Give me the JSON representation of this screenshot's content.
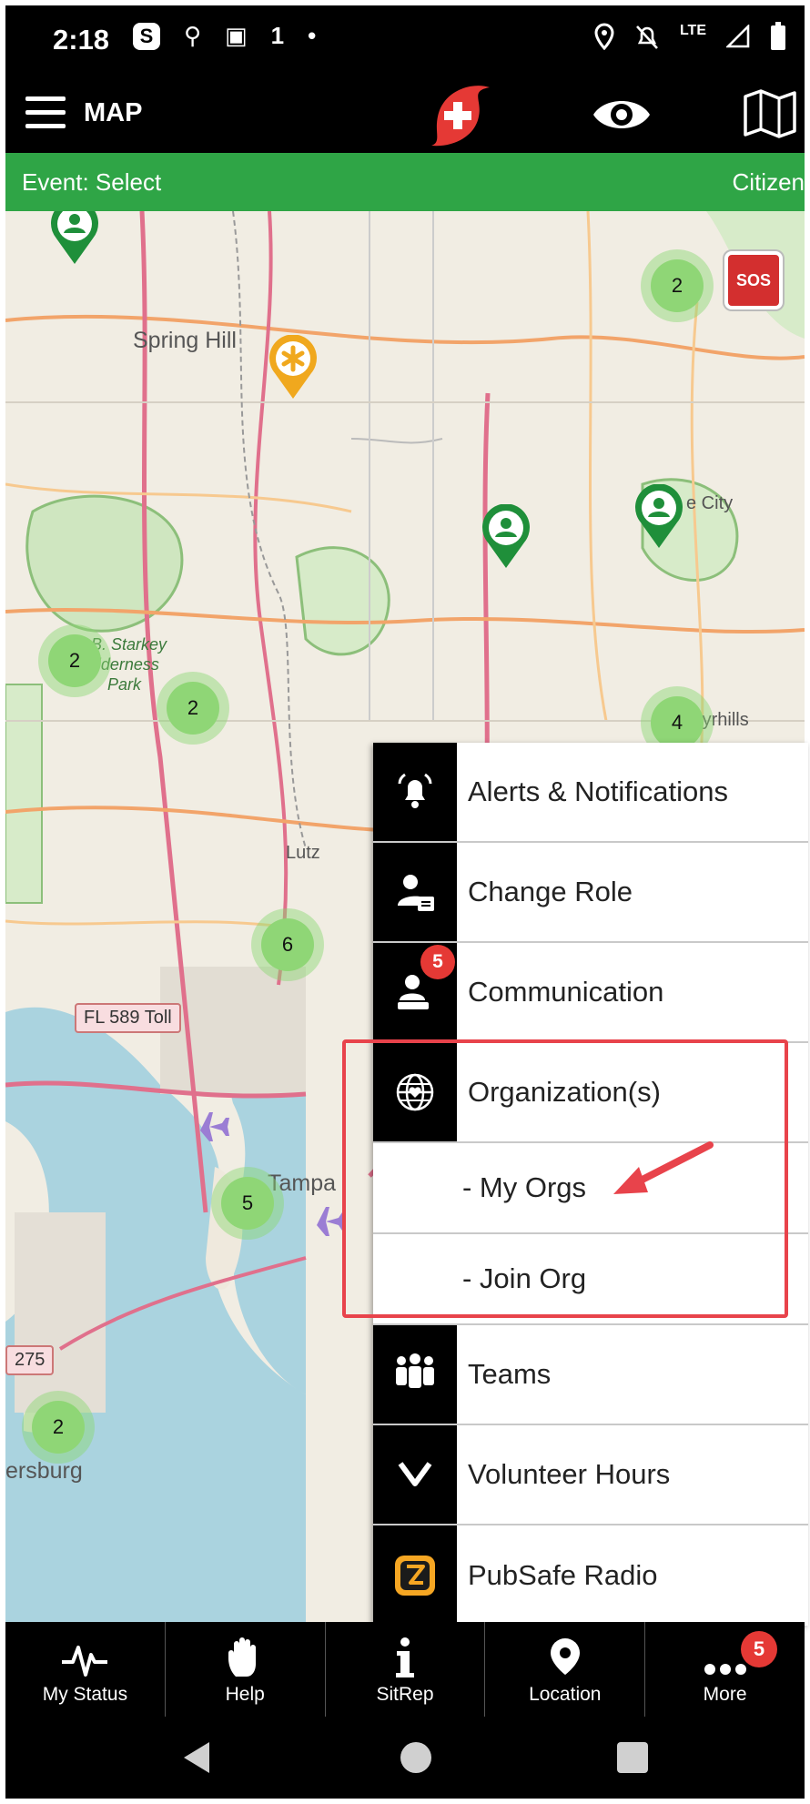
{
  "status_bar": {
    "time": "2:18",
    "icons": [
      "S",
      "⚲",
      "▣",
      "1",
      "•"
    ],
    "network": "LTE"
  },
  "app_bar": {
    "title": "MAP",
    "icons": [
      "menu-icon",
      "logo-icon",
      "eye-icon",
      "map-icon"
    ]
  },
  "event_bar": {
    "event": "Event: Select",
    "role": "Citizen"
  },
  "map": {
    "places": {
      "spring_hill": "Spring Hill",
      "zephyrhills": "Zephyrhills",
      "dade_city": "e City",
      "starkey_1": "J.B. Starkey",
      "starkey_2": "Wilderness",
      "starkey_3": "Park",
      "lutz": "Lutz",
      "tampa": "Tampa",
      "stpete": "ersburg"
    },
    "shields": {
      "toll": "FL 589 Toll",
      "i275": "275"
    },
    "sos_label": "SOS",
    "clusters": [
      {
        "count": "2"
      },
      {
        "count": "2"
      },
      {
        "count": "2"
      },
      {
        "count": "4"
      },
      {
        "count": "6"
      },
      {
        "count": "5"
      },
      {
        "count": "2"
      }
    ]
  },
  "menu": {
    "items": [
      {
        "label": "Alerts & Notifications"
      },
      {
        "label": "Change Role"
      },
      {
        "label": "Communication",
        "badge": "5"
      },
      {
        "label": "Organization(s)"
      },
      {
        "label": "- My Orgs"
      },
      {
        "label": "- Join Org"
      },
      {
        "label": "Teams"
      },
      {
        "label": "Volunteer Hours"
      },
      {
        "label": "PubSafe Radio"
      }
    ]
  },
  "bottom_nav": {
    "items": [
      {
        "label": "My Status"
      },
      {
        "label": "Help"
      },
      {
        "label": "SitRep"
      },
      {
        "label": "Location"
      },
      {
        "label": "More",
        "badge": "5"
      }
    ]
  },
  "colors": {
    "accent_green": "#2fa546",
    "highlight_red": "#e8434b",
    "badge_red": "#e53935",
    "sos_red": "#d32f2f"
  }
}
